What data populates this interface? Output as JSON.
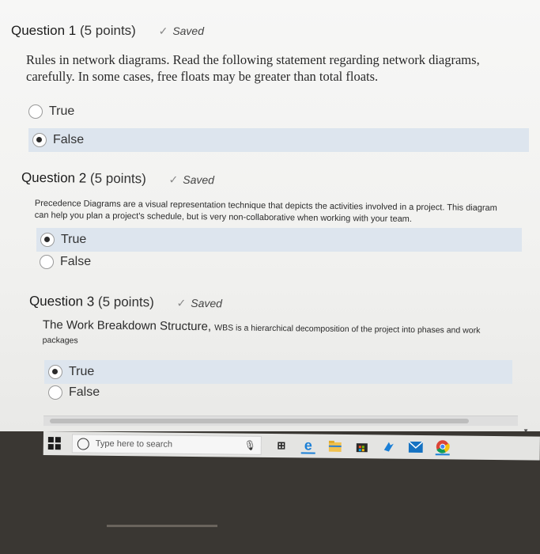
{
  "q1": {
    "number": "Question 1",
    "points": "(5 points)",
    "saved": "Saved",
    "text": "Rules in network diagrams. Read the following statement regarding network diagrams, carefully.  In some cases, free floats may be greater than total floats.",
    "options": [
      "True",
      "False"
    ],
    "selected": "False"
  },
  "q2": {
    "number": "Question 2",
    "points": "(5 points)",
    "saved": "Saved",
    "text": "Precedence Diagrams are a visual representation technique that depicts the activities involved in a project.  This diagram can help you plan a project's schedule, but is very non-collaborative when working with your team.",
    "options": [
      "True",
      "False"
    ],
    "selected": "True"
  },
  "q3": {
    "number": "Question 3",
    "points": "(5 points)",
    "saved": "Saved",
    "text_large": "The Work Breakdown Structure, ",
    "text_small": "WBS is a hierarchical decomposition of the project into phases and work packages",
    "options": [
      "True",
      "False"
    ],
    "selected": "True"
  },
  "taskbar": {
    "search_placeholder": "Type here to search",
    "icons": [
      "windows-start-icon",
      "search-circle-icon",
      "microphone-icon",
      "task-view-icon",
      "edge-browser-icon",
      "file-explorer-icon",
      "store-icon",
      "app-icon",
      "mail-icon",
      "chrome-icon"
    ]
  },
  "colors": {
    "selected_highlight": "#dde5ee",
    "edge_blue": "#1b7fd6",
    "chrome_yellow": "#f4c20d"
  }
}
